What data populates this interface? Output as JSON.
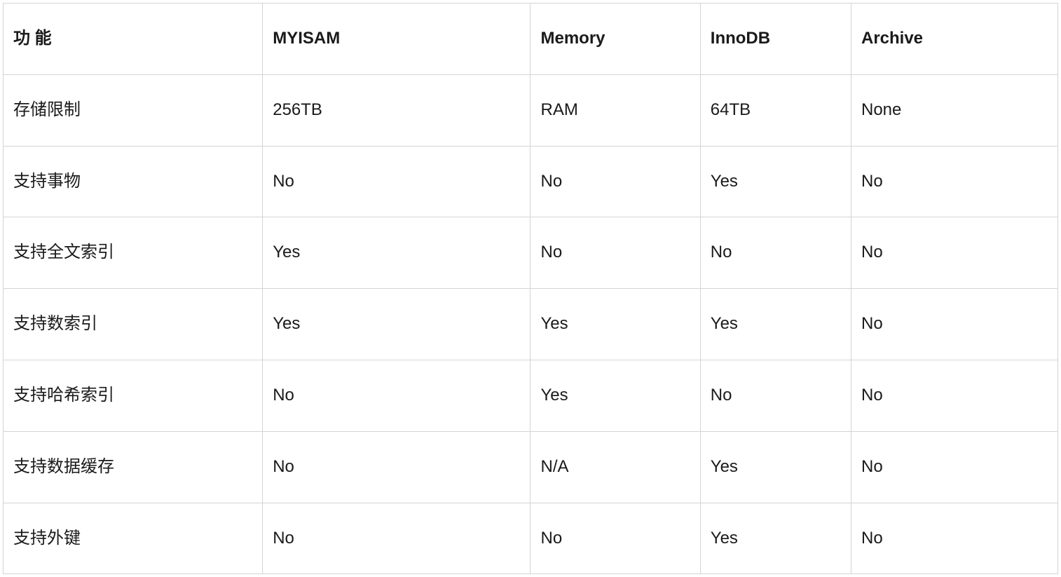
{
  "headers": {
    "feature": "功 能",
    "myisam": "MYISAM",
    "memory": "Memory",
    "innodb": "InnoDB",
    "archive": "Archive"
  },
  "rows": [
    {
      "feature": "存储限制",
      "myisam": "256TB",
      "memory": "RAM",
      "innodb": "64TB",
      "archive": "None"
    },
    {
      "feature": "支持事物",
      "myisam": "No",
      "memory": "No",
      "innodb": "Yes",
      "archive": "No"
    },
    {
      "feature": "支持全文索引",
      "myisam": "Yes",
      "memory": "No",
      "innodb": "No",
      "archive": "No"
    },
    {
      "feature": "支持数索引",
      "myisam": "Yes",
      "memory": "Yes",
      "innodb": "Yes",
      "archive": "No"
    },
    {
      "feature": "支持哈希索引",
      "myisam": "No",
      "memory": "Yes",
      "innodb": "No",
      "archive": "No"
    },
    {
      "feature": "支持数据缓存",
      "myisam": "No",
      "memory": "N/A",
      "innodb": "Yes",
      "archive": "No"
    },
    {
      "feature": "支持外键",
      "myisam": "No",
      "memory": "No",
      "innodb": "Yes",
      "archive": "No"
    }
  ]
}
